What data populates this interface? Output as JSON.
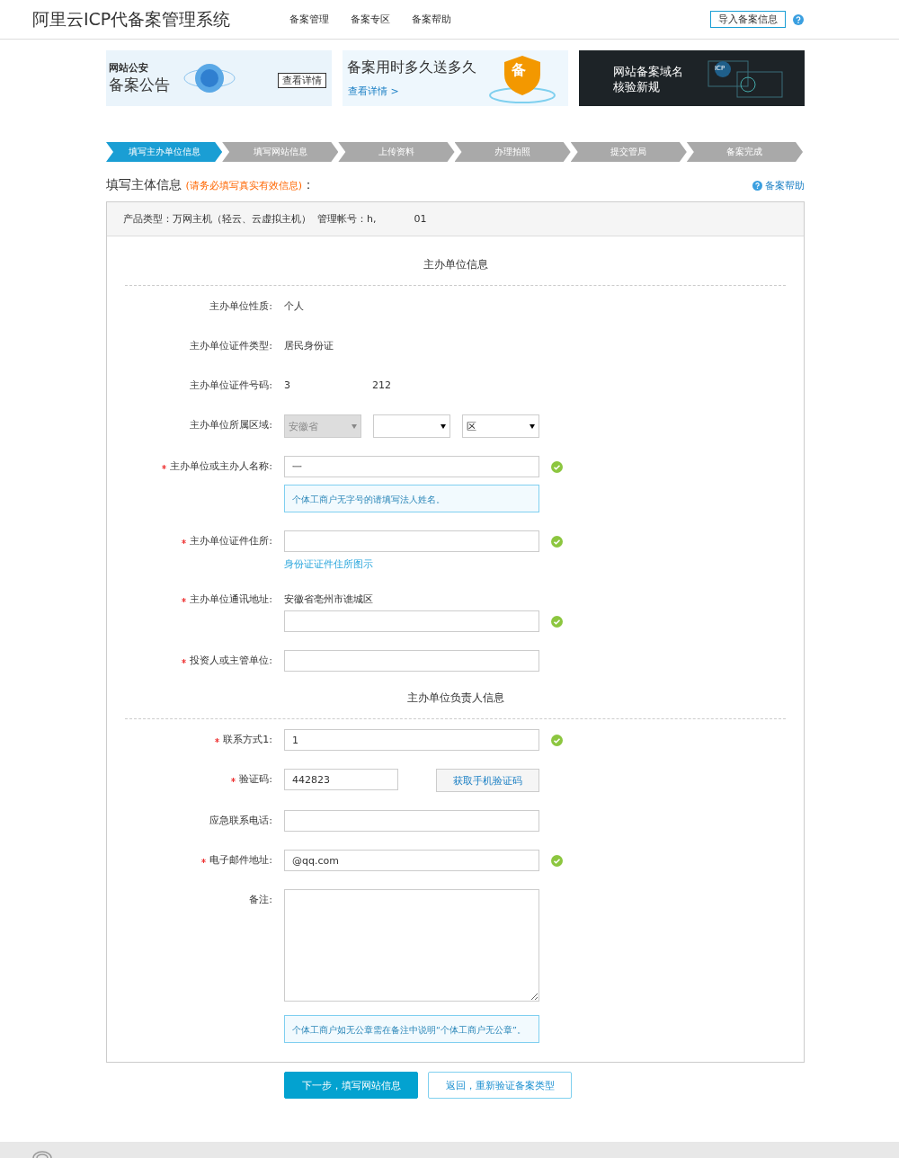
{
  "header": {
    "title": "阿里云ICP代备案管理系统",
    "nav": [
      {
        "label": "备案管理"
      },
      {
        "label": "备案专区"
      },
      {
        "label": "备案帮助"
      }
    ],
    "import_button": "导入备案信息"
  },
  "promos": [
    {
      "kind": "police",
      "subtitle": "网站公安",
      "title": "备案公告",
      "button": "查看详情"
    },
    {
      "kind": "shield",
      "title": "备案用时多久送多久",
      "link": "查看详情 >",
      "badge": "备"
    },
    {
      "kind": "dark",
      "lines": [
        "网站备案域名",
        "核验新规"
      ],
      "badge": "ICP"
    }
  ],
  "steps": [
    {
      "label": "填写主办单位信息",
      "selected": true
    },
    {
      "label": "填写网站信息",
      "selected": false
    },
    {
      "label": "上传资料",
      "selected": false
    },
    {
      "label": "办理拍照",
      "selected": false
    },
    {
      "label": "提交管局",
      "selected": false
    },
    {
      "label": "备案完成",
      "selected": false
    }
  ],
  "heading": {
    "title": "填写主体信息",
    "note": "(请务必填写真实有效信息)",
    "suffix": "：",
    "help": "备案帮助"
  },
  "product": {
    "type_label": "产品类型：万网主机（轻云、云虚拟主机）",
    "account_label": "管理帐号：",
    "account_start": "h,",
    "account_end": "01"
  },
  "sections": [
    {
      "title": "主办单位信息",
      "fields": [
        {
          "kind": "static",
          "label": "主办单位性质:",
          "required": false,
          "value": "个人"
        },
        {
          "kind": "static",
          "label": "主办单位证件类型:",
          "required": false,
          "value": "居民身份证"
        },
        {
          "kind": "static",
          "label": "主办单位证件号码:",
          "required": false,
          "value": "3",
          "value_end": "212"
        },
        {
          "kind": "region",
          "label": "主办单位所属区域:",
          "required": false,
          "selects": [
            {
              "value": "安徽省",
              "disabled": true
            },
            {
              "disabled": false
            },
            {
              "value": "区",
              "disabled": false
            }
          ]
        },
        {
          "kind": "input",
          "label": "主办单位或主办人名称:",
          "required": true,
          "value": "一",
          "valid": true,
          "hint": "个体工商户无字号的请填写法人姓名。"
        },
        {
          "kind": "input",
          "label": "主办单位证件住所:",
          "required": true,
          "valid": true,
          "link": "身份证证件住所图示"
        },
        {
          "kind": "input",
          "label": "主办单位通讯地址:",
          "required": true,
          "prefix": "安徽省亳州市谯城区",
          "valid": true
        },
        {
          "kind": "input",
          "label": "投资人或主管单位:",
          "required": true,
          "valid": false
        }
      ]
    },
    {
      "title": "主办单位负责人信息",
      "fields": [
        {
          "kind": "input",
          "label": "联系方式1:",
          "required": true,
          "value": "1",
          "valid": true
        },
        {
          "kind": "code",
          "label": "验证码:",
          "required": true,
          "value": "442823",
          "button": "获取手机验证码"
        },
        {
          "kind": "input",
          "label": "应急联系电话:",
          "required": false,
          "valid": false
        },
        {
          "kind": "input",
          "label": "电子邮件地址:",
          "required": true,
          "value": "@qq.com",
          "valid": true
        },
        {
          "kind": "textarea",
          "label": "备注:",
          "required": false,
          "hint": "个体工商户如无公章需在备注中说明“个体工商户无公章”。"
        }
      ]
    }
  ],
  "actions": {
    "primary": "下一步，填写网站信息",
    "secondary": "返回，重新验证备案类型"
  }
}
